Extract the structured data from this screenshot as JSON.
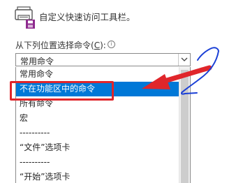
{
  "dialog": {
    "title": "自定义快速访问工具栏。",
    "choose_label_prefix": "从下列位置选择命令(",
    "choose_label_accel": "C",
    "choose_label_suffix": "):",
    "info_icon": "info-icon",
    "info_glyph": "i"
  },
  "dropdown": {
    "selected_value": "常用命令",
    "arrow_icon": "chevron-down-icon",
    "items": [
      {
        "label": "常用命令"
      },
      {
        "label": "不在功能区中的命令",
        "selected": true
      },
      {
        "label": "所有命令"
      },
      {
        "label": "宏"
      },
      {
        "label": "----------"
      },
      {
        "label": "“文件”选项卡"
      },
      {
        "label": "----------"
      },
      {
        "label": "“开始”选项卡"
      }
    ]
  },
  "colors": {
    "selection": "#0078d7",
    "highlight": "#e0262b",
    "pen_stroke": "#1a3fd6"
  }
}
